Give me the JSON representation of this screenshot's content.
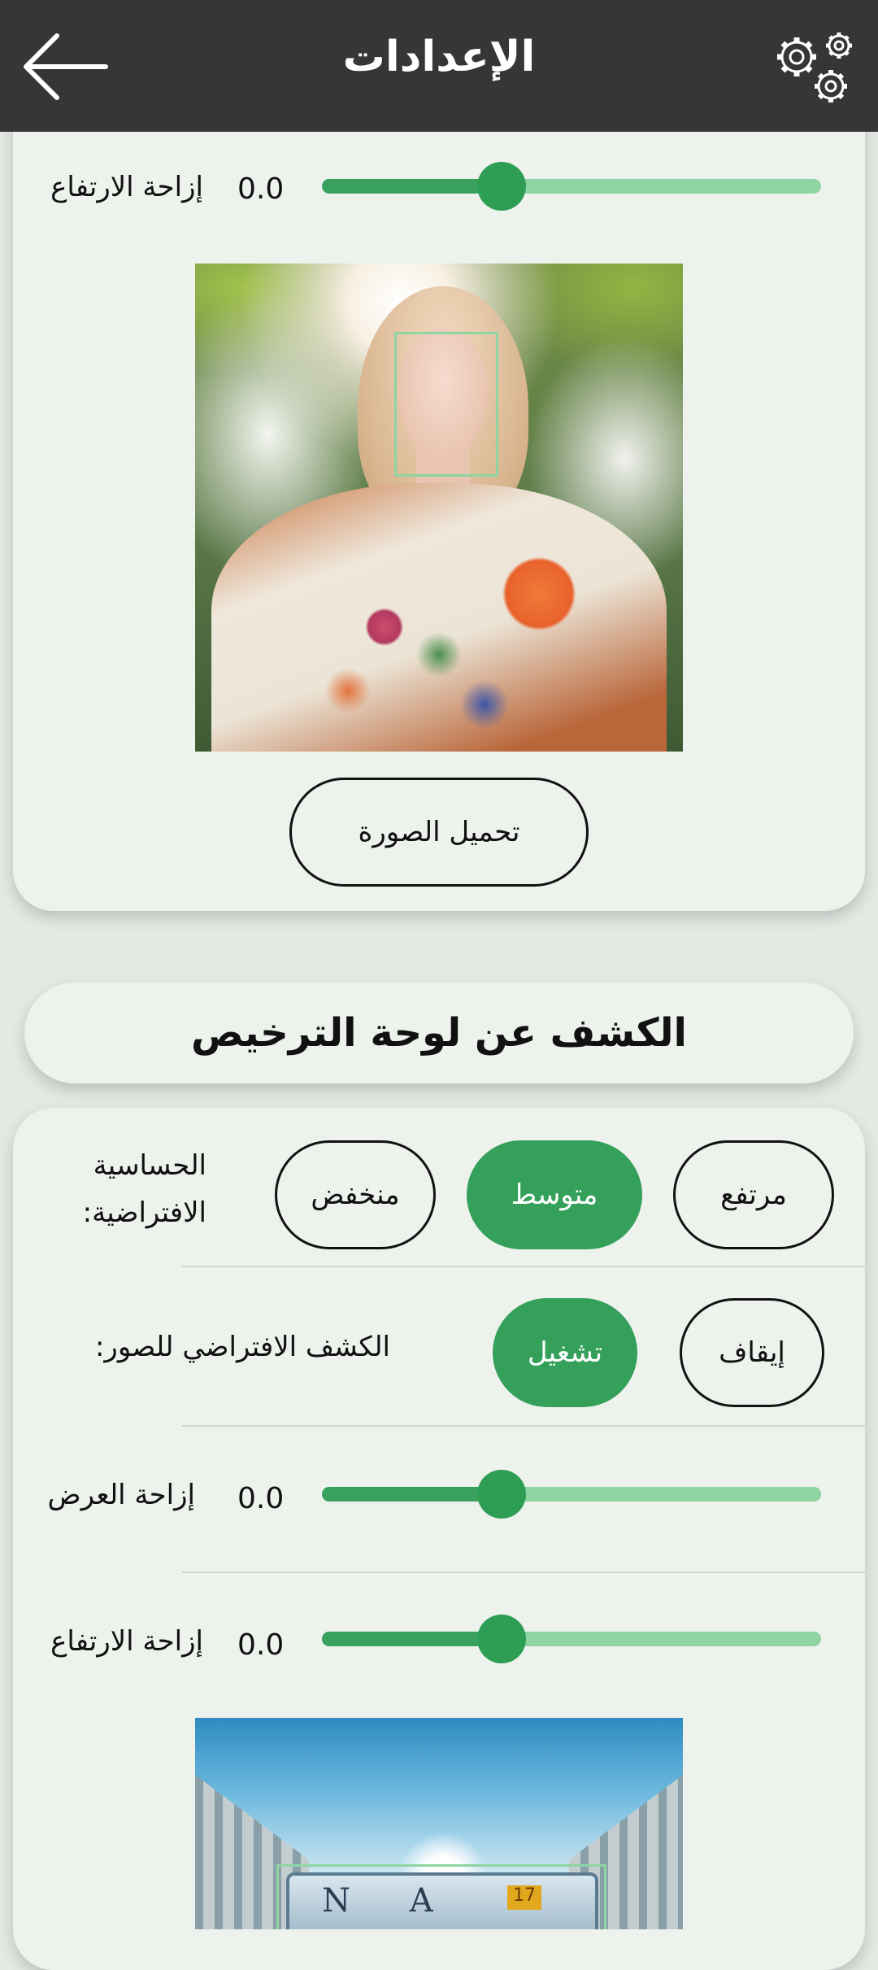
{
  "appbar": {
    "title": "الإعدادات",
    "back_icon": "arrow-left-icon",
    "settings_icon": "gears-icon"
  },
  "face_section": {
    "height_offset_label": "إزاحة الارتفاع",
    "height_offset_value": "0.0",
    "height_offset_level": 0.36,
    "upload_button": "تحميل الصورة"
  },
  "plate_section": {
    "title": "الكشف عن لوحة الترخيص",
    "sensitivity_label_line1": "الحساسية",
    "sensitivity_label_line2": "الافتراضية:",
    "sensitivity_options": [
      "مرتفع",
      "متوسط",
      "منخفض"
    ],
    "sensitivity_selected": "متوسط",
    "image_detection_label": "الكشف الافتراضي للصور:",
    "image_detection_options": [
      "إيقاف",
      "تشغيل"
    ],
    "image_detection_selected": "تشغيل",
    "width_offset_label": "إزاحة العرض",
    "width_offset_value": "0.0",
    "width_offset_level": 0.36,
    "height_offset_label": "إزاحة الارتفاع",
    "height_offset_value": "0.0",
    "height_offset_level": 0.36,
    "plate_text": "N A",
    "plate_sticker": "17"
  },
  "colors": {
    "appbar": "#363636",
    "card": "#edf2ed",
    "accent": "#34a05a",
    "slider_track": "#8fd4a3",
    "detection_box": "#8fd4a3"
  }
}
